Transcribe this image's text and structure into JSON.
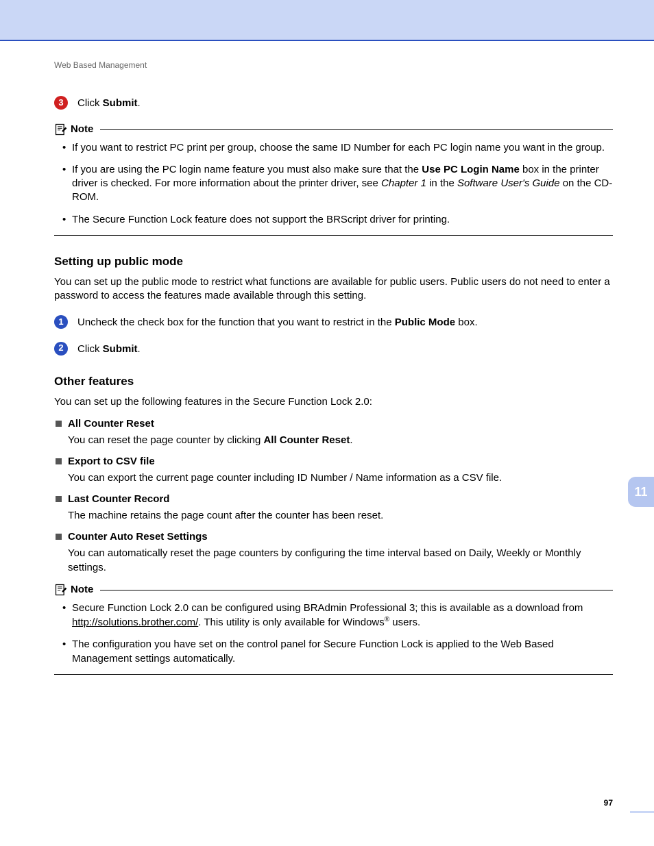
{
  "header": "Web Based Management",
  "step3": {
    "pre": "Click ",
    "bold": "Submit",
    "post": "."
  },
  "note1": {
    "label": "Note",
    "items": [
      {
        "text": "If you want to restrict PC print per group, choose the same ID Number for each PC login name you want in the group."
      },
      {
        "pre": "If you are using the PC login name feature you must also make sure that the ",
        "bold1": "Use PC Login Name",
        "mid": " box in the printer driver is checked. For more information about the printer driver, see ",
        "italic1": "Chapter 1",
        "mid2": " in the ",
        "italic2": "Software User's Guide",
        "post": " on the CD-ROM."
      },
      {
        "text": "The Secure Function Lock feature does not support the BRScript driver for printing."
      }
    ]
  },
  "section1": {
    "title": "Setting up public mode",
    "para": "You can set up the public mode to restrict what functions are available for public users. Public users do not need to enter a password to access the features made available through this setting.",
    "step1": {
      "pre": "Uncheck the check box for the function that you want to restrict in the ",
      "bold": "Public Mode",
      "post": " box."
    },
    "step2": {
      "pre": "Click ",
      "bold": "Submit",
      "post": "."
    }
  },
  "section2": {
    "title": "Other features",
    "para": "You can set up the following features in the Secure Function Lock 2.0:",
    "features": [
      {
        "title": "All Counter Reset",
        "desc_pre": "You can reset the page counter by clicking ",
        "desc_bold": "All Counter Reset",
        "desc_post": "."
      },
      {
        "title": "Export to CSV file",
        "desc": "You can export the current page counter including ID Number / Name information as a CSV file."
      },
      {
        "title": "Last Counter Record",
        "desc": "The machine retains the page count after the counter has been reset."
      },
      {
        "title": "Counter Auto Reset Settings",
        "desc": "You can automatically reset the page counters by configuring the time interval based on Daily, Weekly or Monthly settings."
      }
    ]
  },
  "note2": {
    "label": "Note",
    "items": [
      {
        "pre": "Secure Function Lock 2.0 can be configured using BRAdmin Professional 3; this is available as a download from ",
        "link": "http://solutions.brother.com/",
        "mid": ". This utility is only available for Windows",
        "sup": "®",
        "post": " users."
      },
      {
        "text": "The configuration you have set on the control panel for Secure Function Lock is applied to the Web Based Management settings automatically."
      }
    ]
  },
  "chapter": "11",
  "page": "97"
}
